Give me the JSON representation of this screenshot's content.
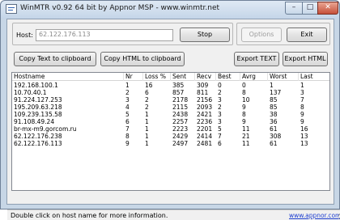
{
  "window": {
    "title": "WinMTR v0.92 64 bit by Appnor MSP - www.winmtr.net",
    "controls": {
      "minimize": "–",
      "maximize": "□",
      "close": "✕"
    }
  },
  "host": {
    "label": "Host:",
    "value": "62.122.176.113"
  },
  "buttons": {
    "stop": "Stop",
    "options": "Options",
    "exit": "Exit",
    "copy_text": "Copy Text to clipboard",
    "copy_html": "Copy HTML to clipboard",
    "export_text": "Export TEXT",
    "export_html": "Export HTML"
  },
  "table": {
    "columns": [
      "Hostname",
      "Nr",
      "Loss %",
      "Sent",
      "Recv",
      "Best",
      "Avrg",
      "Worst",
      "Last"
    ],
    "rows": [
      [
        "192.168.100.1",
        "1",
        "16",
        "385",
        "309",
        "0",
        "0",
        "1",
        "1"
      ],
      [
        "10.70.40.1",
        "2",
        "6",
        "857",
        "811",
        "2",
        "8",
        "137",
        "3"
      ],
      [
        "91.224.127.253",
        "3",
        "2",
        "2178",
        "2156",
        "3",
        "10",
        "85",
        "7"
      ],
      [
        "195.209.63.218",
        "4",
        "2",
        "2115",
        "2093",
        "2",
        "9",
        "85",
        "8"
      ],
      [
        "109.239.135.58",
        "5",
        "1",
        "2438",
        "2421",
        "3",
        "8",
        "38",
        "9"
      ],
      [
        "91.108.49.24",
        "6",
        "1",
        "2257",
        "2236",
        "3",
        "9",
        "36",
        "9"
      ],
      [
        "br-mx-m9.gorcom.ru",
        "7",
        "1",
        "2223",
        "2201",
        "5",
        "11",
        "61",
        "16"
      ],
      [
        "62.122.176.238",
        "8",
        "1",
        "2429",
        "2414",
        "7",
        "21",
        "308",
        "13"
      ],
      [
        "62.122.176.113",
        "9",
        "1",
        "2497",
        "2481",
        "6",
        "11",
        "61",
        "13"
      ]
    ]
  },
  "status": {
    "text": "Double click on host name for more information.",
    "link": "www.appnor.com"
  }
}
